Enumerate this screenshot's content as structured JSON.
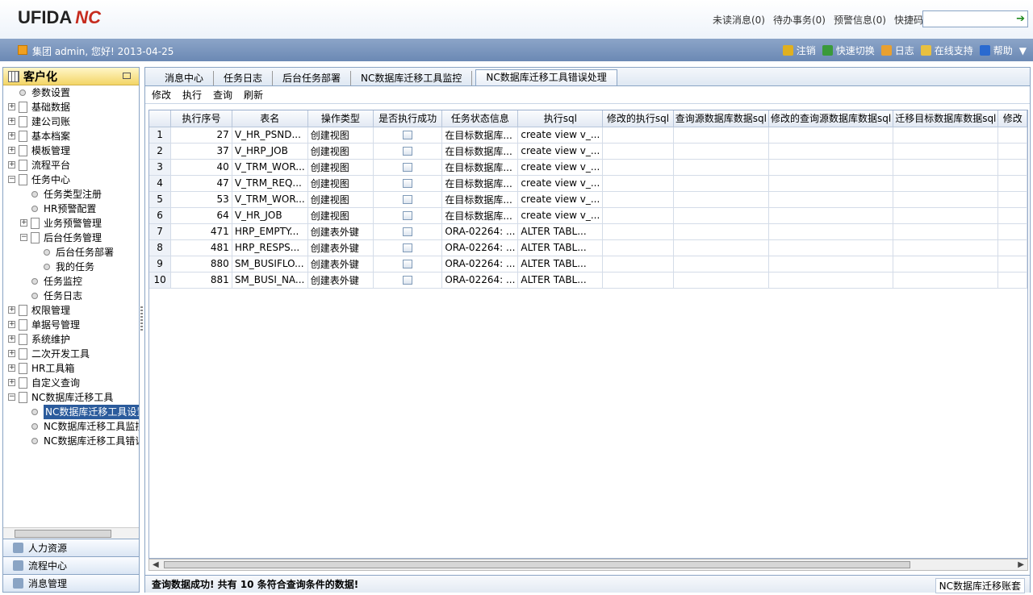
{
  "header": {
    "logo_text": "UFIDA",
    "logo_mark": "NC",
    "links": [
      "未读消息(0)",
      "待办事务(0)",
      "预警信息(0)",
      "快捷码"
    ],
    "quick_input_value": ""
  },
  "userbar": {
    "greeting": "集团 admin, 您好! 2013-04-25",
    "actions": [
      {
        "label": "注销",
        "icon": "key-icon",
        "color": "#e0b020"
      },
      {
        "label": "快速切换",
        "icon": "switch-icon",
        "color": "#3a9a3a"
      },
      {
        "label": "日志",
        "icon": "log-icon",
        "color": "#e8a030"
      },
      {
        "label": "在线支持",
        "icon": "support-icon",
        "color": "#e8c040"
      },
      {
        "label": "帮助",
        "icon": "help-icon",
        "color": "#2a6ad0"
      }
    ]
  },
  "left_panel": {
    "title": "客户化",
    "tree": [
      {
        "label": "参数设置",
        "level": 0,
        "type": "leaf"
      },
      {
        "label": "基础数据",
        "level": 0,
        "type": "folder",
        "expanded": false
      },
      {
        "label": "建公司账",
        "level": 0,
        "type": "folder",
        "expanded": false
      },
      {
        "label": "基本档案",
        "level": 0,
        "type": "folder",
        "expanded": false
      },
      {
        "label": "模板管理",
        "level": 0,
        "type": "folder",
        "expanded": false
      },
      {
        "label": "流程平台",
        "level": 0,
        "type": "folder",
        "expanded": false
      },
      {
        "label": "任务中心",
        "level": 0,
        "type": "folder",
        "expanded": true
      },
      {
        "label": "任务类型注册",
        "level": 1,
        "type": "leaf"
      },
      {
        "label": "HR预警配置",
        "level": 1,
        "type": "leaf"
      },
      {
        "label": "业务预警管理",
        "level": 1,
        "type": "folder",
        "expanded": false
      },
      {
        "label": "后台任务管理",
        "level": 1,
        "type": "folder",
        "expanded": true
      },
      {
        "label": "后台任务部署",
        "level": 2,
        "type": "leaf"
      },
      {
        "label": "我的任务",
        "level": 2,
        "type": "leaf"
      },
      {
        "label": "任务监控",
        "level": 1,
        "type": "leaf"
      },
      {
        "label": "任务日志",
        "level": 1,
        "type": "leaf"
      },
      {
        "label": "权限管理",
        "level": 0,
        "type": "folder",
        "expanded": false
      },
      {
        "label": "单据号管理",
        "level": 0,
        "type": "folder",
        "expanded": false
      },
      {
        "label": "系统维护",
        "level": 0,
        "type": "folder",
        "expanded": false
      },
      {
        "label": "二次开发工具",
        "level": 0,
        "type": "folder",
        "expanded": false
      },
      {
        "label": "HR工具箱",
        "level": 0,
        "type": "folder",
        "expanded": false
      },
      {
        "label": "自定义查询",
        "level": 0,
        "type": "folder",
        "expanded": false
      },
      {
        "label": "NC数据库迁移工具",
        "level": 0,
        "type": "folder",
        "expanded": true
      },
      {
        "label": "NC数据库迁移工具设置",
        "level": 1,
        "type": "leaf",
        "selected": true
      },
      {
        "label": "NC数据库迁移工具监控",
        "level": 1,
        "type": "leaf"
      },
      {
        "label": "NC数据库迁移工具错误处理",
        "level": 1,
        "type": "leaf"
      }
    ],
    "accordion": [
      {
        "label": "人力资源",
        "icon": "people-icon"
      },
      {
        "label": "流程中心",
        "icon": "flow-icon"
      },
      {
        "label": "消息管理",
        "icon": "message-icon"
      }
    ]
  },
  "tabs": [
    "消息中心",
    "任务日志",
    "后台任务部署",
    "NC数据库迁移工具监控",
    "NC数据库迁移工具错误处理"
  ],
  "active_tab": 4,
  "toolbar": [
    "修改",
    "执行",
    "查询",
    "刷新"
  ],
  "grid": {
    "columns": [
      "执行序号",
      "表名",
      "操作类型",
      "是否执行成功",
      "任务状态信息",
      "执行sql",
      "修改的执行sql",
      "查询源数据库数据sql",
      "修改的查询源数据库数据sql",
      "迁移目标数据库数据sql",
      "修改"
    ],
    "rows": [
      {
        "n": "1",
        "seq": "27",
        "table": "V_HR_PSND...",
        "op": "创建视图",
        "status": "在目标数据库...",
        "sql": "create view v_..."
      },
      {
        "n": "2",
        "seq": "37",
        "table": "V_HRP_JOB",
        "op": "创建视图",
        "status": "在目标数据库...",
        "sql": "create view v_..."
      },
      {
        "n": "3",
        "seq": "40",
        "table": "V_TRM_WOR...",
        "op": "创建视图",
        "status": "在目标数据库...",
        "sql": "create view v_..."
      },
      {
        "n": "4",
        "seq": "47",
        "table": "V_TRM_REQ...",
        "op": "创建视图",
        "status": "在目标数据库...",
        "sql": "create view v_..."
      },
      {
        "n": "5",
        "seq": "53",
        "table": "V_TRM_WOR...",
        "op": "创建视图",
        "status": "在目标数据库...",
        "sql": "create view v_..."
      },
      {
        "n": "6",
        "seq": "64",
        "table": "V_HR_JOB",
        "op": "创建视图",
        "status": "在目标数据库...",
        "sql": "create view v_..."
      },
      {
        "n": "7",
        "seq": "471",
        "table": "HRP_EMPTY...",
        "op": "创建表外键",
        "status": "ORA-02264: ...",
        "sql": "ALTER TABL..."
      },
      {
        "n": "8",
        "seq": "481",
        "table": "HRP_RESPS...",
        "op": "创建表外键",
        "status": "ORA-02264: ...",
        "sql": "ALTER TABL..."
      },
      {
        "n": "9",
        "seq": "880",
        "table": "SM_BUSIFLO...",
        "op": "创建表外键",
        "status": "ORA-02264: ...",
        "sql": "ALTER TABL..."
      },
      {
        "n": "10",
        "seq": "881",
        "table": "SM_BUSI_NA...",
        "op": "创建表外键",
        "status": "ORA-02264: ...",
        "sql": "ALTER TABL..."
      }
    ]
  },
  "status": {
    "message": "查询数据成功! 共有 10 条符合查询条件的数据!",
    "right": "NC数据库迁移账套"
  }
}
